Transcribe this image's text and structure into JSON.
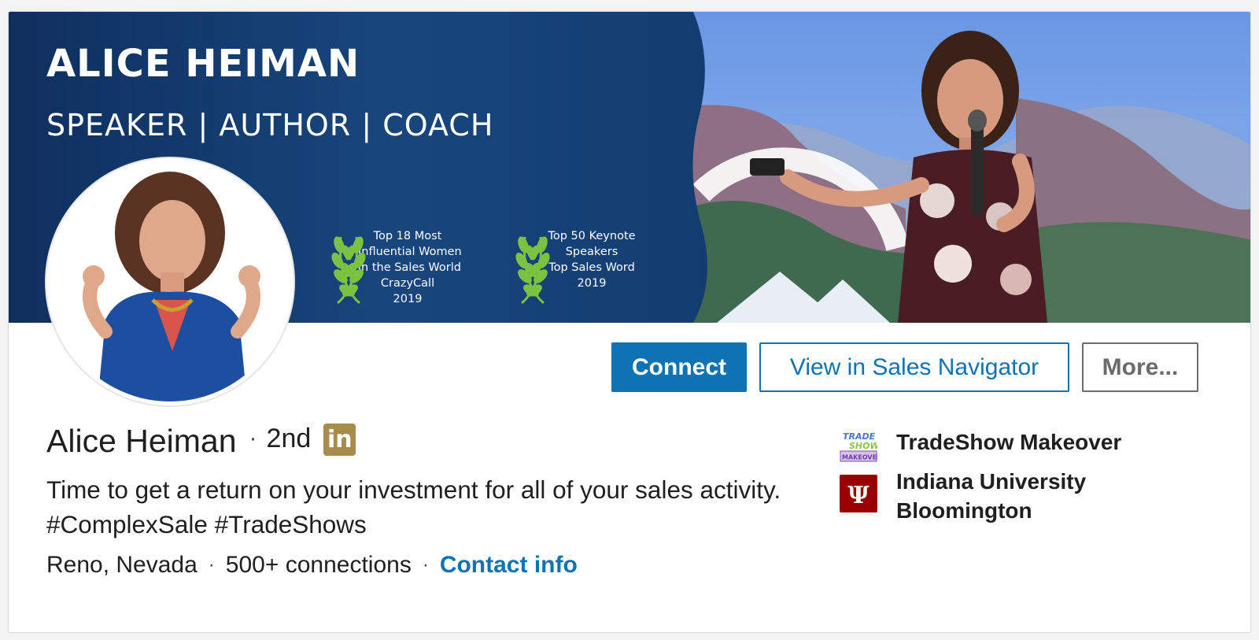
{
  "banner": {
    "title": "ALICE HEIMAN",
    "subtitle": "SPEAKER | AUTHOR | COACH",
    "awards": [
      {
        "lines": [
          "Top 18 Most",
          "Influential Women",
          "in the Sales World",
          "CrazyCall",
          "2019"
        ]
      },
      {
        "lines": [
          "Top 50 Keynote",
          "Speakers",
          "Top Sales Word",
          "2019"
        ]
      }
    ]
  },
  "actions": {
    "connect": "Connect",
    "sales_navigator": "View in Sales Navigator",
    "more": "More..."
  },
  "profile": {
    "name": "Alice Heiman",
    "separator": "·",
    "degree": "2nd",
    "badge": "in",
    "headline": "Time to get a return on your investment for all of your sales activity. #ComplexSale #TradeShows",
    "location": "Reno, Nevada",
    "connections": "500+ connections",
    "contact_info": "Contact info"
  },
  "sidebar": {
    "company": "TradeShow Makeover",
    "company_logo_lines": [
      "TRADE",
      "SHOW",
      "MAKEOVER"
    ],
    "school": "Indiana University Bloomington",
    "school_logo_glyph": "Ψ"
  },
  "colors": {
    "brand_blue": "#0e73b4",
    "banner_navy": "#0f3566",
    "laurel_green": "#7cc242",
    "linkedin_gold": "#a88c4e",
    "iu_crimson": "#990000"
  }
}
